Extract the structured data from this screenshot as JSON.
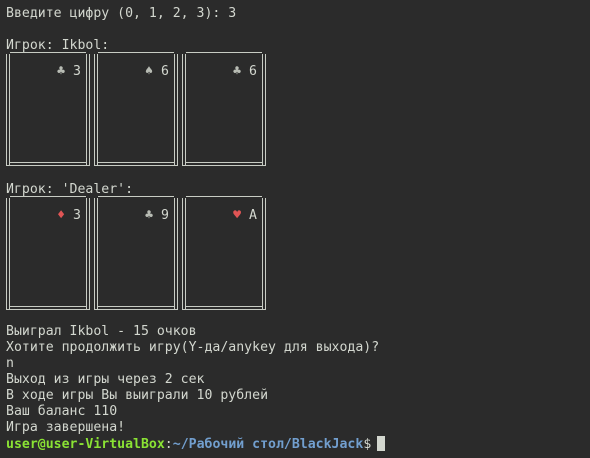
{
  "terminal": {
    "input_prompt": "Введите цифру (0, 1, 2, 3): 3",
    "player": {
      "label": "Игрок: Ikbol:",
      "cards": [
        {
          "suit": "♣",
          "rank": "3",
          "color": "black"
        },
        {
          "suit": "♠",
          "rank": "6",
          "color": "black"
        },
        {
          "suit": "♣",
          "rank": "6",
          "color": "black"
        }
      ]
    },
    "dealer": {
      "label": "Игрок: 'Dealer':",
      "cards": [
        {
          "suit": "♦",
          "rank": "3",
          "color": "red"
        },
        {
          "suit": "♣",
          "rank": "9",
          "color": "black"
        },
        {
          "suit": "♥",
          "rank": "A",
          "color": "red"
        }
      ]
    },
    "messages": [
      "Выиграл Ikbol - 15 очков",
      "Хотите продолжить игру(Y-да/anykey для выхода)?",
      "n",
      "Выход из игры через 2 сек",
      "В ходе игры Вы выиграли 10 рублей",
      "Ваш баланс 110",
      "Игра завершена!"
    ],
    "prompt": {
      "user_host": "user@user-VirtualBox",
      "separator": ":",
      "path": "~/Рабочий стол/BlackJack",
      "symbol": "$"
    }
  },
  "colors": {
    "background": "#2b2b2b",
    "text": "#d3d7cf",
    "user_host": "#8ae234",
    "path": "#729fcf",
    "red_suit": "#e05555"
  }
}
